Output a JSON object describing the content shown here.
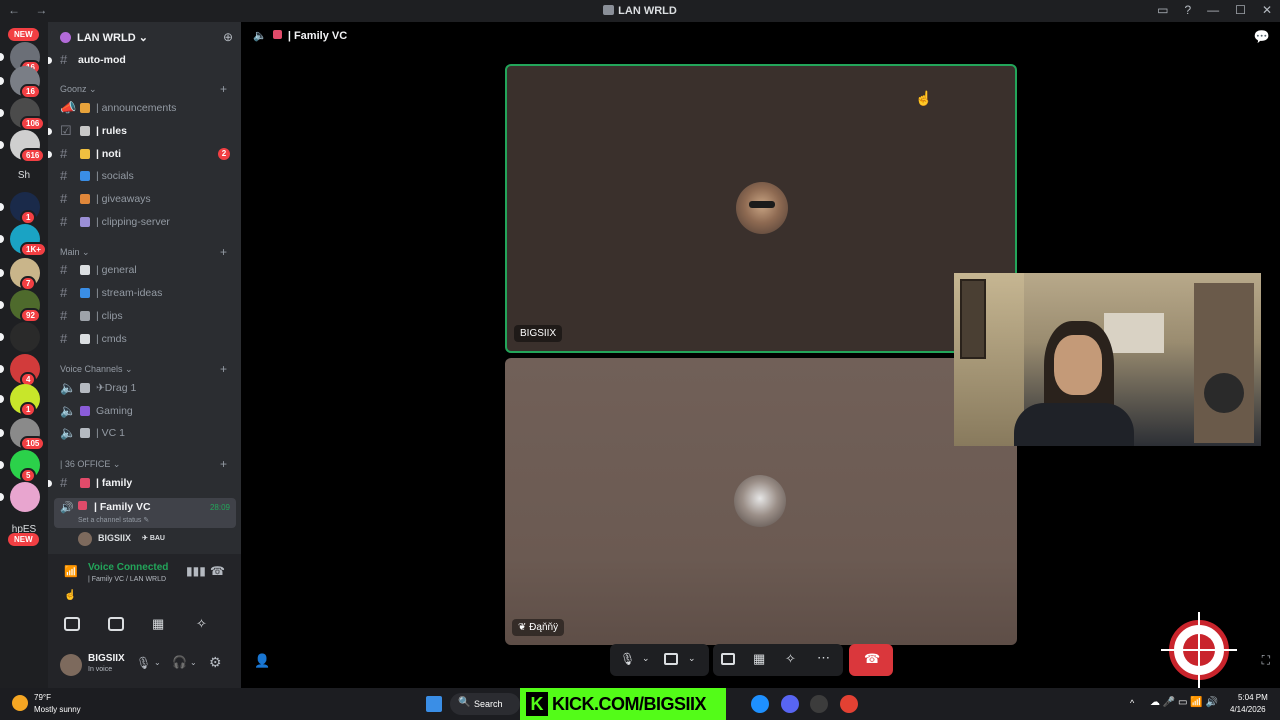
{
  "window": {
    "title": "LAN WRLD",
    "nav_arrows": "← →",
    "controls": [
      "▭",
      "?",
      "—",
      "☐",
      "✕"
    ]
  },
  "server_rail": {
    "items": [
      {
        "badge": "16",
        "color": "#6b6f77"
      },
      {
        "badge": "16",
        "color": "#7a7e86"
      },
      {
        "badge": "106",
        "color": "#4b4b4b"
      },
      {
        "badge": "616",
        "color": "#cfcfcf"
      },
      {
        "label": "Sh"
      },
      {
        "badge": "1",
        "color": "#1a2a4a"
      },
      {
        "badge": "1K+",
        "color": "#1aa3c4"
      },
      {
        "badge": "7",
        "color": "#c9b58a"
      },
      {
        "badge": "92",
        "color": "#4e6a2c"
      },
      {
        "badge": "",
        "color": "#2a2a2a"
      },
      {
        "badge": "4",
        "color": "#d23b3b"
      },
      {
        "badge": "1",
        "color": "#c8e62a"
      },
      {
        "badge": "105",
        "color": "#8a8a8a"
      },
      {
        "badge": "5",
        "color": "#2bd14a"
      },
      {
        "badge": "",
        "color": "#e8a5cf"
      },
      {
        "label": "hpES"
      }
    ],
    "new_label": "NEW"
  },
  "sidebar": {
    "server_name": "LAN WRLD ⌄",
    "top_channel": "auto-mod",
    "categories": [
      {
        "name": "Goonz ⌄",
        "channels": [
          {
            "label": "| announcements",
            "icon": "announce",
            "bold": false
          },
          {
            "label": "| rules",
            "icon": "check",
            "bold": true
          },
          {
            "label": "| noti",
            "icon": "hash",
            "bold": true,
            "mention": "2"
          },
          {
            "label": "| socials",
            "icon": "hash",
            "bold": false
          },
          {
            "label": "| giveaways",
            "icon": "hash",
            "bold": false
          },
          {
            "label": "| clipping-server",
            "icon": "hash",
            "bold": false
          }
        ]
      },
      {
        "name": "Main ⌄",
        "channels": [
          {
            "label": "| general",
            "icon": "hash",
            "bold": false
          },
          {
            "label": "| stream-ideas",
            "icon": "hash",
            "bold": false
          },
          {
            "label": "| clips",
            "icon": "hash",
            "bold": false
          },
          {
            "label": "| cmds",
            "icon": "hash",
            "bold": false
          }
        ]
      },
      {
        "name": "Voice Channels ⌄",
        "channels": [
          {
            "label": "✈Drag 1",
            "icon": "speaker",
            "bold": false
          },
          {
            "label": "Gaming",
            "icon": "speaker",
            "bold": false
          },
          {
            "label": "| VC 1",
            "icon": "speaker",
            "bold": false
          }
        ]
      },
      {
        "name": "| 36 OFFICE ⌄",
        "channels": [
          {
            "label": "| family",
            "icon": "hash",
            "bold": true
          }
        ]
      }
    ],
    "active_voice": {
      "label": "| Family VC",
      "timer": "28:09",
      "status_hint": "Set a channel status ✎",
      "member": "BIGSIIX",
      "member_tag": "BAU"
    },
    "voice_panel": {
      "status": "Voice Connected",
      "channel": "| Family VC / LAN WRLD",
      "user": "BIGSIIX",
      "user_status": "In voice"
    }
  },
  "main": {
    "header_title": "| Family VC",
    "tiles": [
      {
        "name": "BIGSIIX"
      },
      {
        "name": "Đąňňÿ"
      }
    ],
    "call_controls": [
      "mic",
      "camera",
      "share-screen",
      "activities",
      "soundboard",
      "more",
      "disconnect"
    ]
  },
  "taskbar": {
    "weather_temp": "79°F",
    "weather_desc": "Mostly sunny",
    "search_label": "Search",
    "overlay_text": "KICK.COM/BIGSIIX",
    "time": "5:04 PM",
    "date": "4/14/2026"
  }
}
